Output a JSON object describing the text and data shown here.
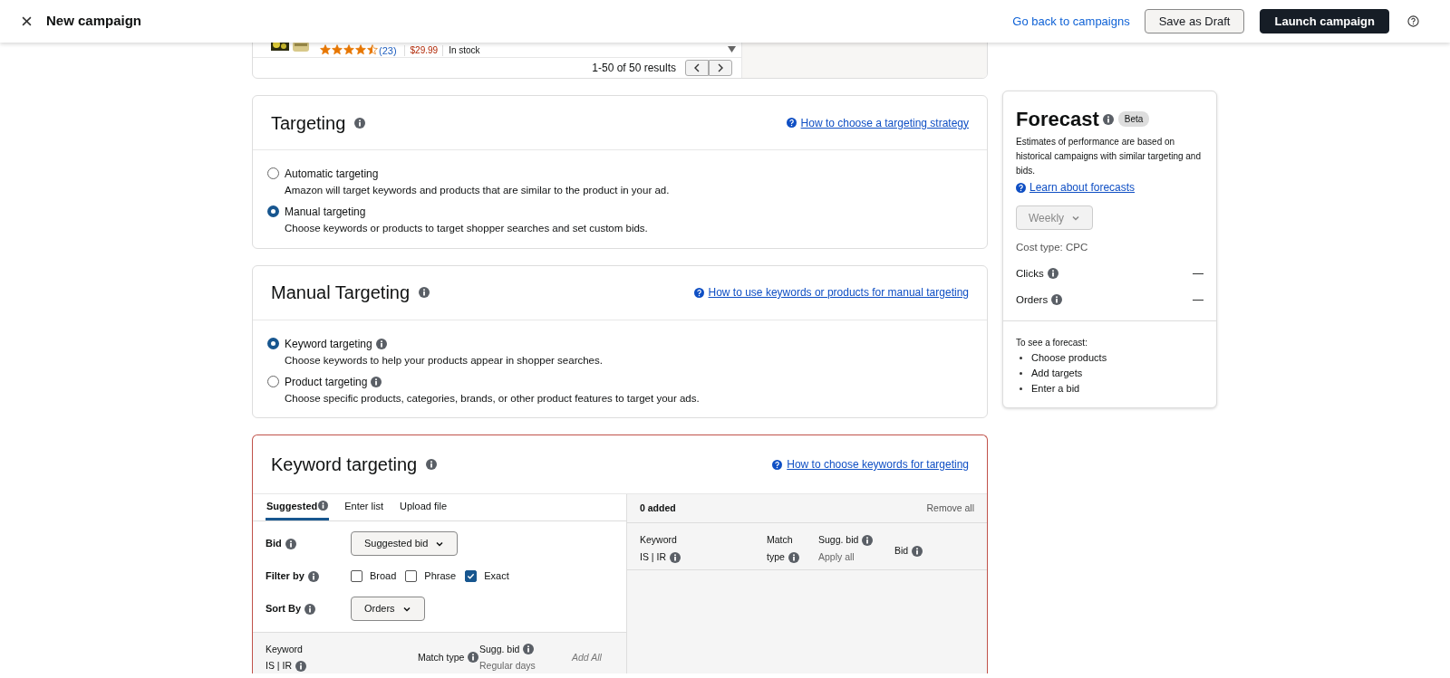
{
  "header": {
    "title": "New campaign",
    "back_link": "Go back to campaigns",
    "buttons": [
      {
        "label": "Save as Draft",
        "kind": "secondary"
      },
      {
        "label": "Launch campaign",
        "kind": "primary"
      }
    ]
  },
  "product_list": {
    "row": {
      "stars": 4.5,
      "review_count": "(23)",
      "price": "$29.99",
      "availability": "In stock"
    },
    "pagination": "1-50 of 50 results"
  },
  "targeting": {
    "title": "Targeting",
    "help_link": "How to choose a targeting strategy",
    "options": [
      {
        "label": "Automatic targeting",
        "description": "Amazon will target keywords and products that are similar to the product in your ad.",
        "selected": false,
        "info": false
      },
      {
        "label": "Manual targeting",
        "description": "Choose keywords or products to target shopper searches and set custom bids.",
        "selected": true,
        "info": false
      }
    ]
  },
  "manual_targeting": {
    "title": "Manual Targeting",
    "help_link": "How to use keywords or products for manual targeting",
    "options": [
      {
        "label": "Keyword targeting",
        "description": "Choose keywords to help your products appear in shopper searches.",
        "selected": true,
        "info": true
      },
      {
        "label": "Product targeting",
        "description": "Choose specific products, categories, brands, or other product features to target your ads.",
        "selected": false,
        "info": true
      }
    ]
  },
  "keyword_targeting": {
    "title": "Keyword targeting",
    "help_link": "How to choose keywords for targeting",
    "tabs": [
      {
        "label": "Suggested",
        "selected": true,
        "info": true
      },
      {
        "label": "Enter list",
        "selected": false,
        "info": false
      },
      {
        "label": "Upload file",
        "selected": false,
        "info": false
      }
    ],
    "bid_label": "Bid",
    "bid_dropdown": "Suggested bid",
    "filter_label": "Filter by",
    "filters": [
      {
        "label": "Broad",
        "checked": false
      },
      {
        "label": "Phrase",
        "checked": false
      },
      {
        "label": "Exact",
        "checked": true
      }
    ],
    "sort_label": "Sort By",
    "sort_dropdown": "Orders",
    "suggestion_columns": [
      {
        "lines": [
          {
            "text": "Keyword",
            "info": false
          },
          {
            "text": "IS | IR",
            "info": true
          }
        ]
      },
      {
        "lines": [
          {
            "text": "Match type",
            "info": true
          }
        ]
      },
      {
        "lines": [
          {
            "text": "Sugg. bid",
            "info": true
          },
          {
            "text": "Regular days",
            "info": false
          }
        ]
      }
    ],
    "add_all": "Add All",
    "added_count": "0 added",
    "remove_all": "Remove all",
    "added_columns": [
      {
        "lines": [
          {
            "text": "Keyword",
            "info": false
          },
          {
            "text": "IS | IR",
            "info": true
          }
        ]
      },
      {
        "lines": [
          {
            "text": "Match",
            "info": false
          },
          {
            "text": "type",
            "info": true
          }
        ]
      },
      {
        "lines": [
          {
            "text": "Sugg. bid",
            "info": true
          },
          {
            "text": "Apply all",
            "info": false
          }
        ]
      },
      {
        "lines": [
          {
            "text": "Bid",
            "info": true
          }
        ]
      }
    ]
  },
  "forecast": {
    "title": "Forecast",
    "badge": "Beta",
    "description": "Estimates of performance are based on historical campaigns with similar targeting and bids.",
    "link": "Learn about forecasts",
    "period": "Weekly",
    "period_disabled": true,
    "cost_type": "Cost type: CPC",
    "metrics": [
      {
        "label": "Clicks",
        "value": "—"
      },
      {
        "label": "Orders",
        "value": "—"
      }
    ],
    "hint": "To see a forecast:",
    "steps": [
      "Choose products",
      "Add targets",
      "Enter a bid"
    ]
  }
}
